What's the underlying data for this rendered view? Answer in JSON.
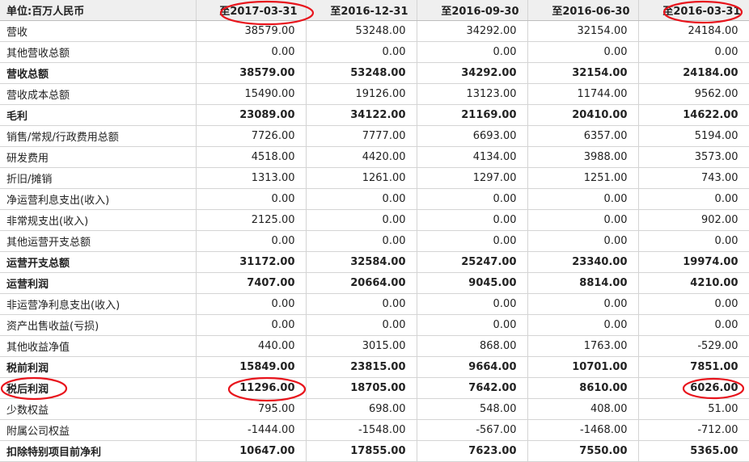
{
  "header": {
    "unit_label": "单位:百万人民币",
    "dates": [
      "至2017-03-31",
      "至2016-12-31",
      "至2016-09-30",
      "至2016-06-30",
      "至2016-03-31"
    ]
  },
  "rows": [
    {
      "label": "营收",
      "bold": false,
      "values": [
        "38579.00",
        "53248.00",
        "34292.00",
        "32154.00",
        "24184.00"
      ]
    },
    {
      "label": "其他营收总额",
      "bold": false,
      "values": [
        "0.00",
        "0.00",
        "0.00",
        "0.00",
        "0.00"
      ]
    },
    {
      "label": "营收总额",
      "bold": true,
      "values": [
        "38579.00",
        "53248.00",
        "34292.00",
        "32154.00",
        "24184.00"
      ]
    },
    {
      "label": "营收成本总额",
      "bold": false,
      "values": [
        "15490.00",
        "19126.00",
        "13123.00",
        "11744.00",
        "9562.00"
      ]
    },
    {
      "label": "毛利",
      "bold": true,
      "values": [
        "23089.00",
        "34122.00",
        "21169.00",
        "20410.00",
        "14622.00"
      ]
    },
    {
      "label": "销售/常规/行政费用总额",
      "bold": false,
      "values": [
        "7726.00",
        "7777.00",
        "6693.00",
        "6357.00",
        "5194.00"
      ]
    },
    {
      "label": "研发费用",
      "bold": false,
      "values": [
        "4518.00",
        "4420.00",
        "4134.00",
        "3988.00",
        "3573.00"
      ]
    },
    {
      "label": "折旧/摊销",
      "bold": false,
      "values": [
        "1313.00",
        "1261.00",
        "1297.00",
        "1251.00",
        "743.00"
      ]
    },
    {
      "label": "净运营利息支出(收入)",
      "bold": false,
      "values": [
        "0.00",
        "0.00",
        "0.00",
        "0.00",
        "0.00"
      ]
    },
    {
      "label": "非常规支出(收入)",
      "bold": false,
      "values": [
        "2125.00",
        "0.00",
        "0.00",
        "0.00",
        "902.00"
      ]
    },
    {
      "label": "其他运营开支总额",
      "bold": false,
      "values": [
        "0.00",
        "0.00",
        "0.00",
        "0.00",
        "0.00"
      ]
    },
    {
      "label": "运营开支总额",
      "bold": true,
      "values": [
        "31172.00",
        "32584.00",
        "25247.00",
        "23340.00",
        "19974.00"
      ]
    },
    {
      "label": "运营利润",
      "bold": true,
      "values": [
        "7407.00",
        "20664.00",
        "9045.00",
        "8814.00",
        "4210.00"
      ]
    },
    {
      "label": "非运营净利息支出(收入)",
      "bold": false,
      "values": [
        "0.00",
        "0.00",
        "0.00",
        "0.00",
        "0.00"
      ]
    },
    {
      "label": "资产出售收益(亏损)",
      "bold": false,
      "values": [
        "0.00",
        "0.00",
        "0.00",
        "0.00",
        "0.00"
      ]
    },
    {
      "label": "其他收益净值",
      "bold": false,
      "values": [
        "440.00",
        "3015.00",
        "868.00",
        "1763.00",
        "-529.00"
      ]
    },
    {
      "label": "税前利润",
      "bold": true,
      "values": [
        "15849.00",
        "23815.00",
        "9664.00",
        "10701.00",
        "7851.00"
      ]
    },
    {
      "label": "税后利润",
      "bold": true,
      "values": [
        "11296.00",
        "18705.00",
        "7642.00",
        "8610.00",
        "6026.00"
      ]
    },
    {
      "label": "少数权益",
      "bold": false,
      "values": [
        "795.00",
        "698.00",
        "548.00",
        "408.00",
        "51.00"
      ]
    },
    {
      "label": "附属公司权益",
      "bold": false,
      "values": [
        "-1444.00",
        "-1548.00",
        "-567.00",
        "-1468.00",
        "-712.00"
      ]
    },
    {
      "label": "扣除特别项目前净利",
      "bold": true,
      "values": [
        "10647.00",
        "17855.00",
        "7623.00",
        "7550.00",
        "5365.00"
      ]
    }
  ],
  "annotation_color": "#e8141c"
}
